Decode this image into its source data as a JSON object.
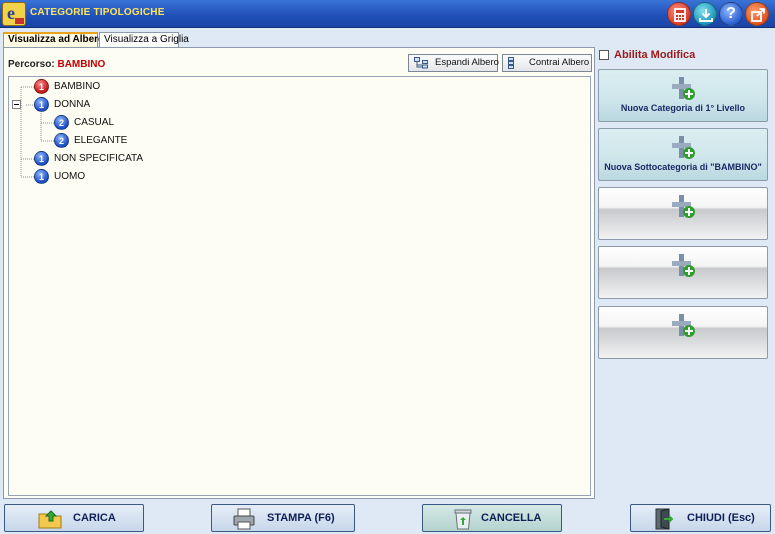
{
  "window": {
    "title": "CATEGORIE TIPOLOGICHE",
    "help_label": "?"
  },
  "tabs": [
    {
      "label": "Visualizza ad Albero",
      "active": true
    },
    {
      "label": "Visualizza a Griglia",
      "active": false
    }
  ],
  "percorso": {
    "label": "Percorso:",
    "value": "BAMBINO"
  },
  "toolbar": {
    "espandi": "Espandi Albero",
    "contrai": "Contrai Albero"
  },
  "tree": [
    {
      "label": "BAMBINO",
      "level": "1",
      "selected": true
    },
    {
      "label": "DONNA",
      "level": "1",
      "expanded": true
    },
    {
      "label": "CASUAL",
      "level": "2"
    },
    {
      "label": "ELEGANTE",
      "level": "2"
    },
    {
      "label": "NON SPECIFICATA",
      "level": "1"
    },
    {
      "label": "UOMO",
      "level": "1"
    }
  ],
  "side": {
    "abilita_modifica": "Abilita Modifica",
    "buttons": [
      {
        "label": "Nuova Categoria di 1° Livello"
      },
      {
        "label": "Nuova Sottocategoria di \"BAMBINO\""
      },
      {
        "label": ""
      },
      {
        "label": ""
      },
      {
        "label": ""
      }
    ]
  },
  "bottom": {
    "carica": "CARICA",
    "stampa": "STAMPA (F6)",
    "cancella": "CANCELLA",
    "chiudi": "CHIUDI  (Esc)"
  },
  "colors": {
    "titlebar": "#1f4fb8",
    "title_text": "#ffe45c",
    "path_value": "#c00000",
    "abilita": "#9e1a1a",
    "badge_level1_selected": "#c41818",
    "badge_level": "#1c4fc4"
  }
}
